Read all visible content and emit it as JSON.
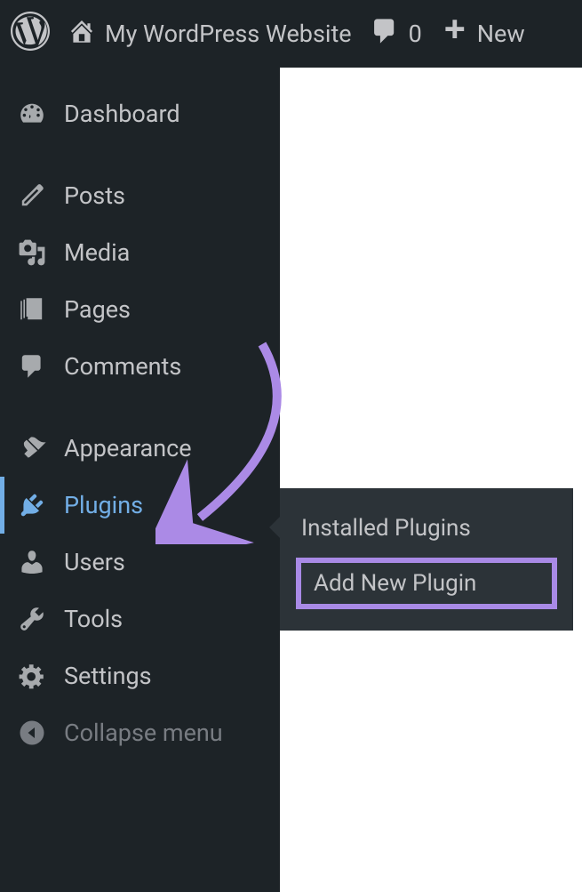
{
  "adminBar": {
    "siteName": "My WordPress Website",
    "commentCount": "0",
    "newLabel": "New"
  },
  "sidebar": {
    "items": [
      {
        "id": "dashboard",
        "label": "Dashboard"
      },
      {
        "id": "posts",
        "label": "Posts"
      },
      {
        "id": "media",
        "label": "Media"
      },
      {
        "id": "pages",
        "label": "Pages"
      },
      {
        "id": "comments",
        "label": "Comments"
      },
      {
        "id": "appearance",
        "label": "Appearance"
      },
      {
        "id": "plugins",
        "label": "Plugins"
      },
      {
        "id": "users",
        "label": "Users"
      },
      {
        "id": "tools",
        "label": "Tools"
      },
      {
        "id": "settings",
        "label": "Settings"
      }
    ],
    "collapseLabel": "Collapse menu"
  },
  "submenu": {
    "items": [
      {
        "label": "Installed Plugins",
        "highlighted": false
      },
      {
        "label": "Add New Plugin",
        "highlighted": true
      }
    ]
  }
}
